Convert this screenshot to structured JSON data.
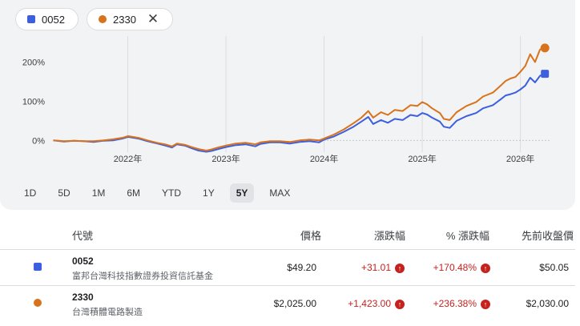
{
  "chips": [
    {
      "label": "0052",
      "color": "#3c5fe0"
    },
    {
      "label": "2330",
      "color": "#d9731b",
      "close": "✕"
    }
  ],
  "chart_data": {
    "type": "line",
    "y_ticks": [
      "0%",
      "100%",
      "200%"
    ],
    "x_ticks": [
      "2022年",
      "2023年",
      "2024年",
      "2025年",
      "2026年"
    ],
    "ylim": [
      -30,
      250
    ],
    "xlim": [
      2021.22,
      2026.33
    ],
    "grid": "vertical",
    "series": [
      {
        "name": "0052",
        "color": "#3c5fe0",
        "points": [
          [
            2021.24,
            0
          ],
          [
            2021.35,
            -3
          ],
          [
            2021.45,
            -1
          ],
          [
            2021.55,
            -2
          ],
          [
            2021.65,
            -4
          ],
          [
            2021.75,
            -1
          ],
          [
            2021.85,
            0
          ],
          [
            2021.95,
            5
          ],
          [
            2022.0,
            9
          ],
          [
            2022.05,
            7
          ],
          [
            2022.12,
            4
          ],
          [
            2022.2,
            -2
          ],
          [
            2022.3,
            -8
          ],
          [
            2022.38,
            -13
          ],
          [
            2022.45,
            -18
          ],
          [
            2022.5,
            -10
          ],
          [
            2022.58,
            -13
          ],
          [
            2022.65,
            -20
          ],
          [
            2022.72,
            -26
          ],
          [
            2022.8,
            -29
          ],
          [
            2022.85,
            -27
          ],
          [
            2022.92,
            -22
          ],
          [
            2023.0,
            -17
          ],
          [
            2023.1,
            -12
          ],
          [
            2023.2,
            -10
          ],
          [
            2023.3,
            -15
          ],
          [
            2023.35,
            -9
          ],
          [
            2023.45,
            -5
          ],
          [
            2023.55,
            -5
          ],
          [
            2023.65,
            -8
          ],
          [
            2023.75,
            -4
          ],
          [
            2023.85,
            -2
          ],
          [
            2023.95,
            -5
          ],
          [
            2024.0,
            2
          ],
          [
            2024.1,
            10
          ],
          [
            2024.2,
            22
          ],
          [
            2024.3,
            35
          ],
          [
            2024.38,
            48
          ],
          [
            2024.45,
            60
          ],
          [
            2024.5,
            42
          ],
          [
            2024.58,
            52
          ],
          [
            2024.65,
            45
          ],
          [
            2024.72,
            55
          ],
          [
            2024.8,
            52
          ],
          [
            2024.88,
            65
          ],
          [
            2024.95,
            62
          ],
          [
            2025.0,
            70
          ],
          [
            2025.05,
            66
          ],
          [
            2025.1,
            58
          ],
          [
            2025.18,
            48
          ],
          [
            2025.22,
            35
          ],
          [
            2025.28,
            32
          ],
          [
            2025.35,
            50
          ],
          [
            2025.45,
            62
          ],
          [
            2025.55,
            70
          ],
          [
            2025.62,
            82
          ],
          [
            2025.72,
            90
          ],
          [
            2025.8,
            105
          ],
          [
            2025.85,
            115
          ],
          [
            2025.9,
            118
          ],
          [
            2025.95,
            122
          ],
          [
            2026.0,
            130
          ],
          [
            2026.05,
            140
          ],
          [
            2026.1,
            160
          ],
          [
            2026.15,
            148
          ],
          [
            2026.2,
            165
          ],
          [
            2026.25,
            170
          ]
        ]
      },
      {
        "name": "2330",
        "color": "#d9731b",
        "points": [
          [
            2021.24,
            0
          ],
          [
            2021.35,
            -2
          ],
          [
            2021.45,
            -1
          ],
          [
            2021.55,
            -2
          ],
          [
            2021.65,
            -2
          ],
          [
            2021.75,
            0
          ],
          [
            2021.85,
            3
          ],
          [
            2021.95,
            7
          ],
          [
            2022.0,
            11
          ],
          [
            2022.05,
            9
          ],
          [
            2022.12,
            6
          ],
          [
            2022.2,
            0
          ],
          [
            2022.3,
            -6
          ],
          [
            2022.38,
            -10
          ],
          [
            2022.45,
            -15
          ],
          [
            2022.5,
            -8
          ],
          [
            2022.58,
            -11
          ],
          [
            2022.65,
            -17
          ],
          [
            2022.72,
            -22
          ],
          [
            2022.8,
            -26
          ],
          [
            2022.85,
            -23
          ],
          [
            2022.92,
            -18
          ],
          [
            2023.0,
            -13
          ],
          [
            2023.1,
            -8
          ],
          [
            2023.2,
            -6
          ],
          [
            2023.3,
            -10
          ],
          [
            2023.35,
            -5
          ],
          [
            2023.45,
            -2
          ],
          [
            2023.55,
            -2
          ],
          [
            2023.65,
            -4
          ],
          [
            2023.75,
            0
          ],
          [
            2023.85,
            2
          ],
          [
            2023.95,
            0
          ],
          [
            2024.0,
            5
          ],
          [
            2024.1,
            15
          ],
          [
            2024.2,
            28
          ],
          [
            2024.3,
            44
          ],
          [
            2024.38,
            58
          ],
          [
            2024.45,
            75
          ],
          [
            2024.5,
            58
          ],
          [
            2024.58,
            72
          ],
          [
            2024.65,
            65
          ],
          [
            2024.72,
            78
          ],
          [
            2024.8,
            75
          ],
          [
            2024.88,
            90
          ],
          [
            2024.95,
            88
          ],
          [
            2025.0,
            98
          ],
          [
            2025.05,
            92
          ],
          [
            2025.1,
            82
          ],
          [
            2025.18,
            70
          ],
          [
            2025.22,
            55
          ],
          [
            2025.28,
            52
          ],
          [
            2025.35,
            72
          ],
          [
            2025.45,
            88
          ],
          [
            2025.55,
            98
          ],
          [
            2025.62,
            112
          ],
          [
            2025.72,
            122
          ],
          [
            2025.8,
            140
          ],
          [
            2025.85,
            152
          ],
          [
            2025.9,
            158
          ],
          [
            2025.95,
            162
          ],
          [
            2026.0,
            175
          ],
          [
            2026.05,
            190
          ],
          [
            2026.1,
            220
          ],
          [
            2026.15,
            200
          ],
          [
            2026.2,
            232
          ],
          [
            2026.25,
            236
          ]
        ]
      }
    ]
  },
  "ranges": [
    {
      "label": "1D",
      "active": false
    },
    {
      "label": "5D",
      "active": false
    },
    {
      "label": "1M",
      "active": false
    },
    {
      "label": "6M",
      "active": false
    },
    {
      "label": "YTD",
      "active": false
    },
    {
      "label": "1Y",
      "active": false
    },
    {
      "label": "5Y",
      "active": true
    },
    {
      "label": "MAX",
      "active": false
    }
  ],
  "table": {
    "headers": {
      "code": "代號",
      "price": "價格",
      "change": "漲跌幅",
      "pct": "% 漲跌幅",
      "prev": "先前收盤價"
    },
    "rows": [
      {
        "symbol": "0052",
        "name": "富邦台灣科技指數證券投資信託基金",
        "price": "$49.20",
        "change": "+31.01",
        "pct": "+170.48%",
        "prev": "$50.05",
        "color": "#3c5fe0",
        "marker": "square"
      },
      {
        "symbol": "2330",
        "name": "台灣積體電路製造",
        "price": "$2,025.00",
        "change": "+1,423.00",
        "pct": "+236.38%",
        "prev": "$2,030.00",
        "color": "#d9731b",
        "marker": "circle"
      }
    ],
    "arrow": "↑"
  }
}
